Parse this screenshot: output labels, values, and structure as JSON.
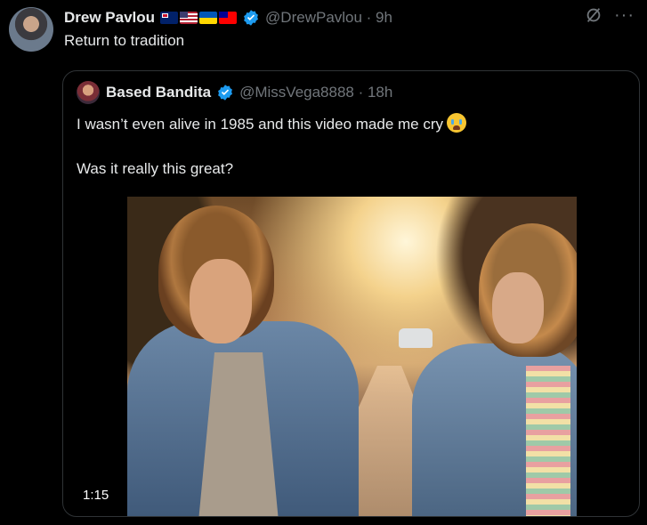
{
  "tweet": {
    "author_name": "Drew Pavlou",
    "flags": [
      "australia-flag",
      "united-states-flag",
      "ukraine-flag",
      "taiwan-flag"
    ],
    "handle_time": "@DrewPavlou · 9h",
    "text": "Return to tradition",
    "more": "···"
  },
  "quote": {
    "author_name": "Based Bandita",
    "handle_time": "@MissVega8888 · 18h",
    "line1": "I wasn’t even alive in 1985 and this video made me cry",
    "line2": "Was it really this great?",
    "emoji": "loudly-crying-face-emoji",
    "video_duration": "1:15"
  },
  "colors": {
    "background": "#000000",
    "text": "#e7e9ea",
    "secondary": "#71767b",
    "verified": "#1d9bf0",
    "border": "#2f3336"
  }
}
